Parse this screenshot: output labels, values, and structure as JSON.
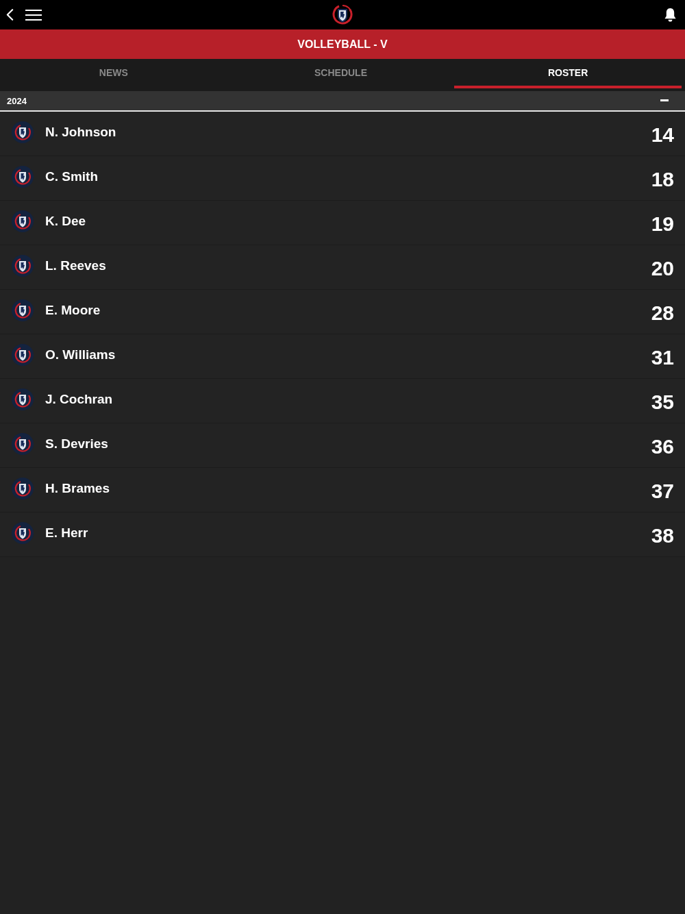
{
  "header": {
    "title": "VOLLEYBALL - V"
  },
  "tabs": [
    {
      "label": "NEWS",
      "selected": false
    },
    {
      "label": "SCHEDULE",
      "selected": false
    },
    {
      "label": "ROSTER",
      "selected": true
    }
  ],
  "section": {
    "label": "2024",
    "expanded": true
  },
  "players": [
    {
      "name": "N. Johnson",
      "number": "14"
    },
    {
      "name": "C. Smith",
      "number": "18"
    },
    {
      "name": "K. Dee",
      "number": "19"
    },
    {
      "name": "L. Reeves",
      "number": "20"
    },
    {
      "name": "E. Moore",
      "number": "28"
    },
    {
      "name": "O. Williams",
      "number": "31"
    },
    {
      "name": "J. Cochran",
      "number": "35"
    },
    {
      "name": "S. Devries",
      "number": "36"
    },
    {
      "name": "H. Brames",
      "number": "37"
    },
    {
      "name": "E. Herr",
      "number": "38"
    }
  ]
}
